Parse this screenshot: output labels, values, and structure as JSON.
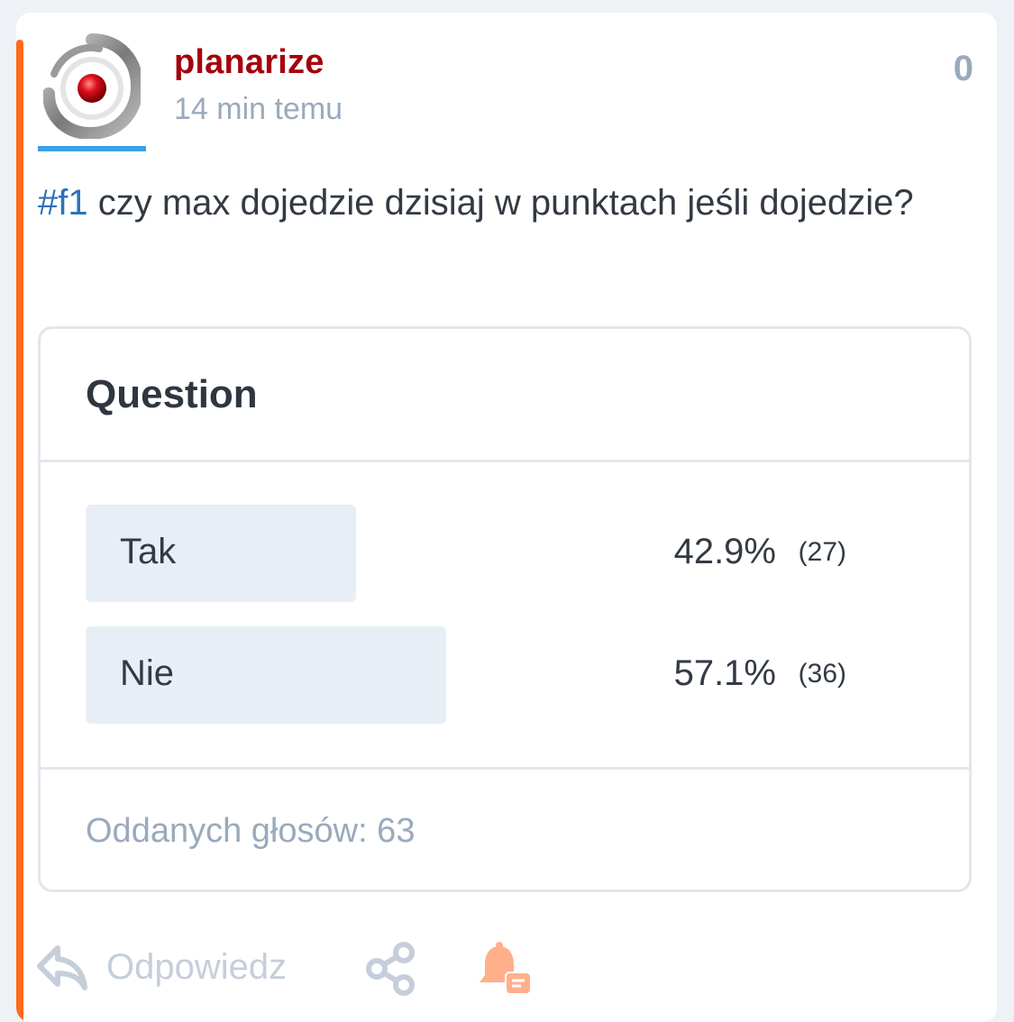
{
  "post": {
    "author": "planarize",
    "time": "14 min temu",
    "score": "0",
    "hashtag": "#f1",
    "text": " czy max dojedzie dzisiaj w punktach jeśli dojedzie?"
  },
  "poll": {
    "title": "Question",
    "options": [
      {
        "label": "Tak",
        "percent": "42.9%",
        "count": "(27)",
        "share": 0.429
      },
      {
        "label": "Nie",
        "percent": "57.1%",
        "count": "(36)",
        "share": 0.571
      }
    ],
    "summary": "Oddanych głosów: 63"
  },
  "actions": {
    "reply_label": "Odpowiedz",
    "reply_icon": "reply-icon",
    "share_icon": "share-icon",
    "notify_icon": "bell-comment-icon"
  },
  "colors": {
    "accent": "#ff6a1a",
    "author": "#a4000d",
    "muted": "#9aaabd",
    "tag": "#2d72b8",
    "bell": "#ffb08a"
  }
}
